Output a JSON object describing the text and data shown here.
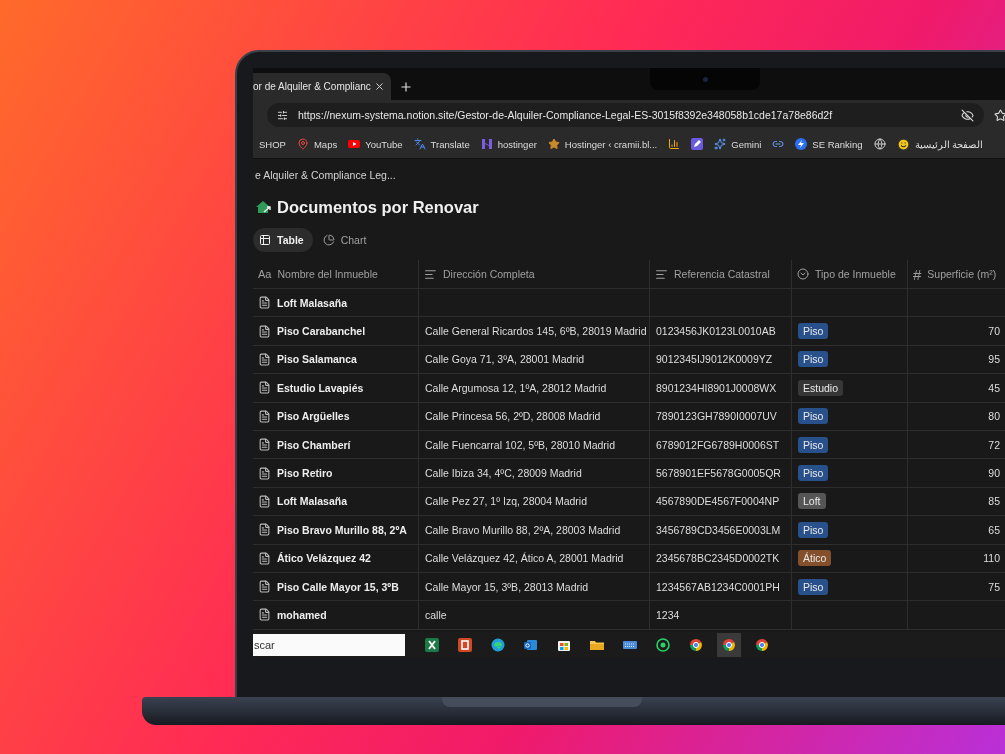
{
  "browser": {
    "tab": {
      "title": "or de Alquiler & Complianc",
      "selected": true
    },
    "url": "https://nexum-systema.notion.site/Gestor-de-Alquiler-Compliance-Legal-ES-3015f8392e348058b1cde17a78e86d2f",
    "bookmarks": [
      {
        "kind": "shop",
        "label": "SHOP"
      },
      {
        "kind": "maps",
        "label": "Maps"
      },
      {
        "kind": "youtube",
        "label": "YouTube"
      },
      {
        "kind": "translate",
        "label": "Translate"
      },
      {
        "kind": "hostinger",
        "label": "hostinger"
      },
      {
        "kind": "star",
        "label": "Hostinger ‹ cramii.bl..."
      },
      {
        "kind": "analytics"
      },
      {
        "kind": "pencil"
      },
      {
        "kind": "gemini",
        "label": "Gemini"
      },
      {
        "kind": "link"
      },
      {
        "kind": "seranking",
        "label": "SE Ranking"
      },
      {
        "kind": "globe"
      },
      {
        "kind": "smile",
        "label": "الصفحة الرئيسية"
      }
    ]
  },
  "breadcrumb": "e Alquiler & Compliance Leg...",
  "page_title": "Documentos por Renovar",
  "views": [
    {
      "kind": "table",
      "label": "Table",
      "selected": true
    },
    {
      "kind": "chart",
      "label": "Chart",
      "selected": false
    }
  ],
  "table": {
    "columns": [
      {
        "kind": "title",
        "icon_text": "Aa",
        "label": "Nombre del Inmueble"
      },
      {
        "kind": "text",
        "label": "Dirección Completa"
      },
      {
        "kind": "text",
        "label": "Referencia Catastral"
      },
      {
        "kind": "select",
        "label": "Tipo de Inmueble"
      },
      {
        "kind": "number",
        "icon_text": "#",
        "label": "Superficie (m²)"
      }
    ],
    "rows": [
      {
        "name": "Loft Malasaña"
      },
      {
        "name": "Piso Carabanchel",
        "address": "Calle General Ricardos 145, 6ºB, 28019 Madrid",
        "reference": "0123456JK0123L0010AB",
        "type": {
          "label": "Piso",
          "color": "#28508a"
        },
        "surface": "70"
      },
      {
        "name": "Piso Salamanca",
        "address": "Calle Goya 71, 3ºA, 28001 Madrid",
        "reference": "9012345IJ9012K0009YZ",
        "type": {
          "label": "Piso",
          "color": "#28508a"
        },
        "surface": "95"
      },
      {
        "name": "Estudio Lavapiés",
        "address": "Calle Argumosa 12, 1ºA, 28012 Madrid",
        "reference": "8901234HI8901J0008WX",
        "type": {
          "label": "Estudio",
          "color": "#373737"
        },
        "surface": "45"
      },
      {
        "name": "Piso Argüelles",
        "address": "Calle Princesa 56, 2ºD, 28008 Madrid",
        "reference": "7890123GH7890I0007UV",
        "type": {
          "label": "Piso",
          "color": "#28508a"
        },
        "surface": "80"
      },
      {
        "name": "Piso Chamberí",
        "address": "Calle Fuencarral 102, 5ºB, 28010 Madrid",
        "reference": "6789012FG6789H0006ST",
        "type": {
          "label": "Piso",
          "color": "#28508a"
        },
        "surface": "72"
      },
      {
        "name": "Piso Retiro",
        "address": "Calle Ibiza 34, 4ºC, 28009 Madrid",
        "reference": "5678901EF5678G0005QR",
        "type": {
          "label": "Piso",
          "color": "#28508a"
        },
        "surface": "90"
      },
      {
        "name": "Loft Malasaña",
        "address": "Calle Pez 27, 1º Izq, 28004 Madrid",
        "reference": "4567890DE4567F0004NP",
        "type": {
          "label": "Loft",
          "color": "#555555"
        },
        "surface": "85"
      },
      {
        "name": "Piso Bravo Murillo 88, 2ºA",
        "address": "Calle Bravo Murillo 88, 2ºA, 28003 Madrid",
        "reference": "3456789CD3456E0003LM",
        "type": {
          "label": "Piso",
          "color": "#28508a"
        },
        "surface": "65"
      },
      {
        "name": "Ático Velázquez 42",
        "address": "Calle Velázquez 42, Ático A, 28001 Madrid",
        "reference": "2345678BC2345D0002TK",
        "type": {
          "label": "Ático",
          "color": "#84502c"
        },
        "surface": "110"
      },
      {
        "name": "Piso Calle Mayor 15, 3ºB",
        "address": "Calle Mayor 15, 3ºB, 28013 Madrid",
        "reference": "1234567AB1234C0001PH",
        "type": {
          "label": "Piso",
          "color": "#28508a"
        },
        "surface": "75"
      },
      {
        "name": "mohamed",
        "address": "calle",
        "reference": "1234"
      }
    ]
  },
  "taskbar": {
    "search": {
      "value": "scar"
    },
    "apps": [
      {
        "kind": "excel",
        "selected": false
      },
      {
        "kind": "powerpoint",
        "selected": false
      },
      {
        "kind": "edge",
        "selected": false
      },
      {
        "kind": "outlook",
        "selected": false
      },
      {
        "kind": "store",
        "selected": false
      },
      {
        "kind": "folder",
        "selected": false
      },
      {
        "kind": "keyboard",
        "selected": false
      },
      {
        "kind": "whatsapp",
        "selected": false
      },
      {
        "kind": "chrome",
        "selected": false
      },
      {
        "kind": "chrome",
        "selected": true
      },
      {
        "kind": "chrome",
        "selected": false
      }
    ]
  }
}
